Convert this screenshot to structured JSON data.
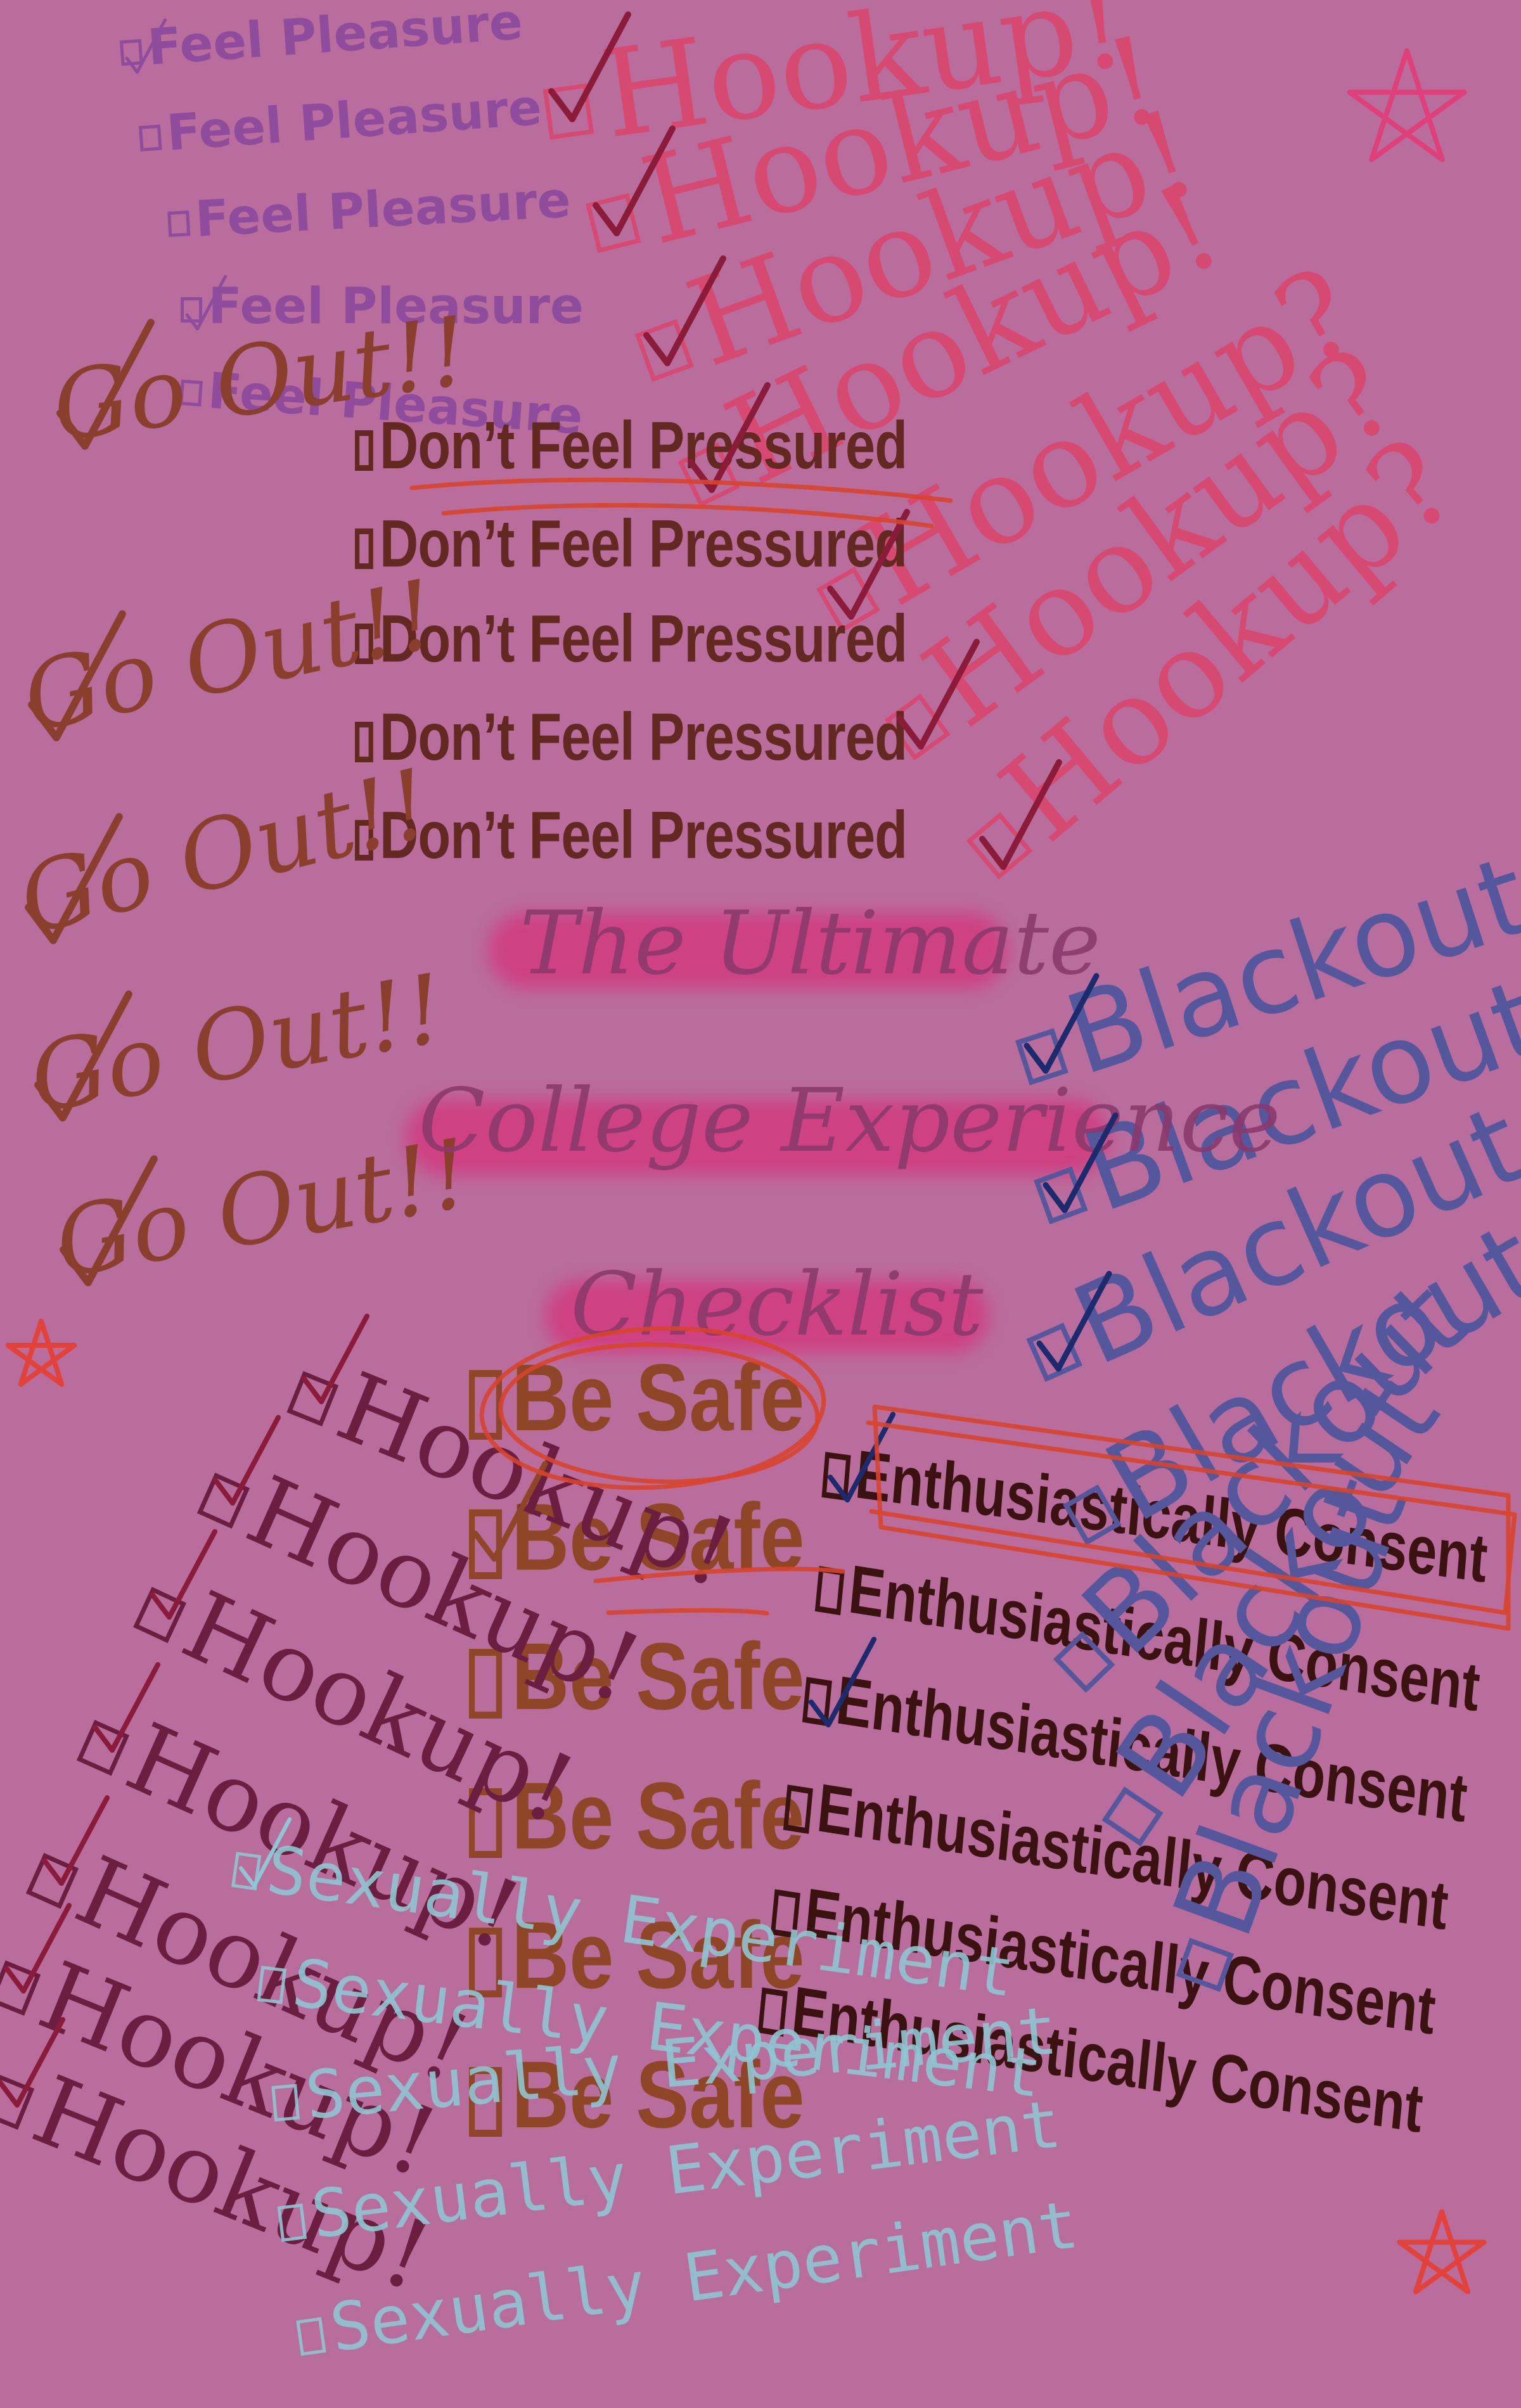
{
  "poster": {
    "background": "#b96d9d",
    "colors": {
      "feel_pleasure": "#8f4c9c",
      "hookup_pink": "#d64a72",
      "dont_feel_pressured": "#63281f",
      "go_out": "#8a3e2c",
      "title": "#8a3a6c",
      "title_highlight": "#d4367c",
      "be_safe": "#8e4626",
      "enthusiastically_consent": "#3a1210",
      "blackout": "#55579c",
      "hookup_dark": "#6c1e40",
      "sexually_experiment": "#8ec6d2",
      "red_marker": "#d8442c",
      "star_red": "#e2423a",
      "star_pink": "#e0407a"
    },
    "title_lines": [
      "The Ultimate",
      "College Experience",
      "Checklist"
    ],
    "feel_pleasure": [
      {
        "label": "Feel Pleasure",
        "checked": true
      },
      {
        "label": "Feel Pleasure",
        "checked": false
      },
      {
        "label": "Feel Pleasure",
        "checked": false
      },
      {
        "label": "Feel Pleasure",
        "checked": true
      },
      {
        "label": "Feel Pleasure",
        "checked": false
      }
    ],
    "hookup_pink": [
      {
        "label": "Hookup!",
        "checked": true
      },
      {
        "label": "Hookup!",
        "checked": true
      },
      {
        "label": "Hookup!",
        "checked": true
      },
      {
        "label": "Hookup!",
        "checked": true
      },
      {
        "label": "Hookup?",
        "checked": true
      },
      {
        "label": "Hookup?",
        "checked": true
      },
      {
        "label": "Hookup?",
        "checked": true
      }
    ],
    "dont_feel_pressured": [
      {
        "label": "Don’t Feel Pressured",
        "checked": false
      },
      {
        "label": "Don’t Feel Pressured",
        "checked": false
      },
      {
        "label": "Don’t Feel Pressured",
        "checked": false
      },
      {
        "label": "Don’t Feel Pressured",
        "checked": false
      },
      {
        "label": "Don’t Feel Pressured",
        "checked": false
      }
    ],
    "go_out": [
      {
        "label": "Go Out!!",
        "checked": true
      },
      {
        "label": "Go Out!!",
        "checked": true
      },
      {
        "label": "Go Out!!",
        "checked": true
      },
      {
        "label": "Go Out!!",
        "checked": true
      },
      {
        "label": "Go Out!!",
        "checked": true
      }
    ],
    "be_safe": [
      {
        "label": "Be Safe",
        "checked": false
      },
      {
        "label": "Be Safe",
        "checked": true
      },
      {
        "label": "Be Safe",
        "checked": false
      },
      {
        "label": "Be Safe",
        "checked": false
      },
      {
        "label": "Be Safe",
        "checked": false
      },
      {
        "label": "Be Safe",
        "checked": false
      }
    ],
    "enthusiastically_consent": [
      {
        "label": "Enthusiastically Consent",
        "checked": true
      },
      {
        "label": "Enthusiastically Consent",
        "checked": false
      },
      {
        "label": "Enthusiastically Consent",
        "checked": true
      },
      {
        "label": "Enthusiastically Consent",
        "checked": false
      },
      {
        "label": "Enthusiastically Consent",
        "checked": false
      },
      {
        "label": "Enthusiastically Consent",
        "checked": false
      }
    ],
    "blackout": [
      {
        "label": "Blackout",
        "checked": true
      },
      {
        "label": "Blackout",
        "checked": true
      },
      {
        "label": "Blackout",
        "checked": true
      },
      {
        "label": "Blackout",
        "checked": false
      },
      {
        "label": "Blackout",
        "checked": false
      },
      {
        "label": "Blackout",
        "checked": false
      },
      {
        "label": "Blackout",
        "checked": false
      }
    ],
    "hookup_dark": [
      {
        "label": "Hookup!",
        "checked": true
      },
      {
        "label": "Hookup!",
        "checked": true
      },
      {
        "label": "Hookup!",
        "checked": true
      },
      {
        "label": "Hookup!",
        "checked": true
      },
      {
        "label": "Hookup!",
        "checked": true
      },
      {
        "label": "Hookup!",
        "checked": true
      },
      {
        "label": "Hookup!",
        "checked": true
      }
    ],
    "sexually_experiment": [
      {
        "label": "Sexually Experiment",
        "checked": true
      },
      {
        "label": "Sexually Experiment",
        "checked": false
      },
      {
        "label": "Sexually Experiment",
        "checked": false
      },
      {
        "label": "Sexually Experiment",
        "checked": false
      },
      {
        "label": "Sexually Experiment",
        "checked": false
      }
    ]
  }
}
